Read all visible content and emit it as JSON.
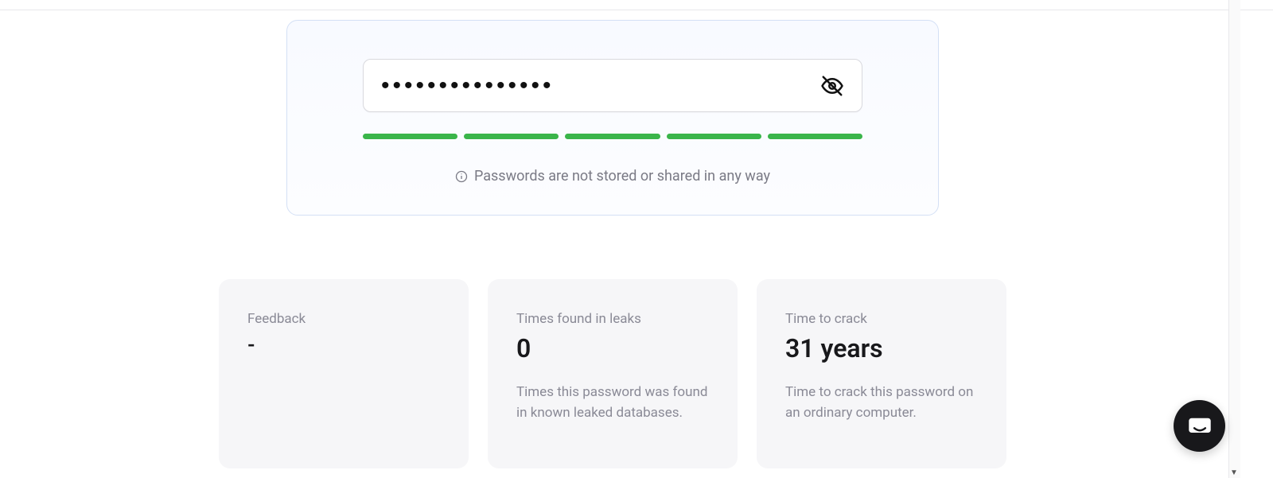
{
  "password_field": {
    "value": "•••••••••••••••",
    "placeholder": ""
  },
  "strength": {
    "segments": 5,
    "filled": 5,
    "color": "#3ab54a"
  },
  "hint": "Passwords are not stored or shared in any way",
  "cards": [
    {
      "title": "Feedback",
      "value": "-",
      "desc": ""
    },
    {
      "title": "Times found in leaks",
      "value": "0",
      "desc": "Times this password was found in known leaked databases."
    },
    {
      "title": "Time to crack",
      "value": "31 years",
      "desc": "Time to crack this password on an ordinary computer."
    }
  ]
}
